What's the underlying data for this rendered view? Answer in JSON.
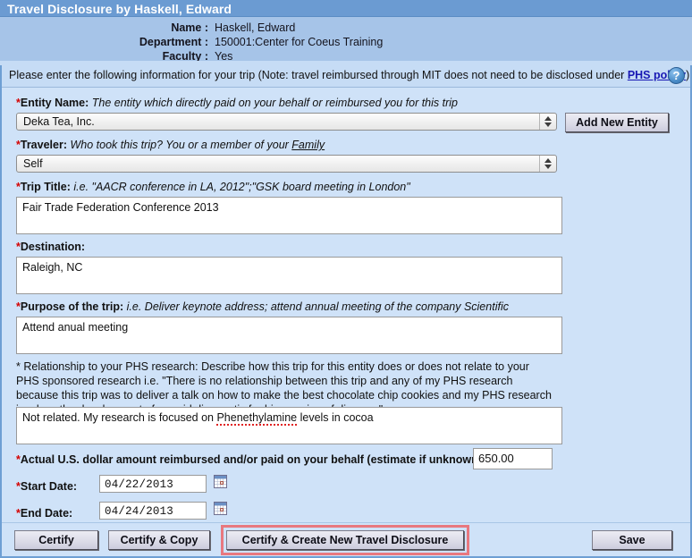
{
  "window": {
    "title": "Travel Disclosure by Haskell, Edward"
  },
  "person_info": {
    "rows": [
      {
        "label": "Name :",
        "value": "Haskell, Edward"
      },
      {
        "label": "Department :",
        "value": "150001:Center for Coeus Training"
      },
      {
        "label": "Faculty :",
        "value": "Yes"
      }
    ]
  },
  "instruction": {
    "text_before": "Please enter the following information for your trip (Note: travel reimbursed through MIT does not need to be disclosed under ",
    "link_label": "PHS policy",
    "text_after": ")",
    "help_icon": "question-mark-icon",
    "help_glyph": "?"
  },
  "fields": {
    "entity_name": {
      "star": "*",
      "label": "Entity Name:",
      "hint": "The entity which directly paid on your behalf or reimbursed you for this trip",
      "selected_value": "Deka Tea, Inc.",
      "add_button_label": "Add New Entity"
    },
    "traveler": {
      "star": "*",
      "label": "Traveler:",
      "hint_part1": "Who took this trip? You or a member of your ",
      "hint_link": "Family",
      "selected_value": "Self"
    },
    "trip_title": {
      "star": "*",
      "label": "Trip Title:",
      "hint": "i.e. \"AACR conference in LA, 2012\";\"GSK board meeting in London\"",
      "value": "Fair Trade Federation Conference 2013"
    },
    "destination": {
      "star": "*",
      "label": "Destination:",
      "hint": "",
      "value": "Raleigh, NC"
    },
    "purpose": {
      "star": "*",
      "label": "Purpose of the trip:",
      "hint": "i.e. Deliver keynote address; attend annual meeting of the company Scientific",
      "value": "Attend anual meeting"
    },
    "relationship": {
      "star": "*",
      "label": "Relationship to your PHS research:",
      "hint": "Describe how this trip for this entity does or does not relate to your PHS sponsored research i.e. \"There is no relationship between this trip and any of my PHS research because this trip was to deliver a talk on how to make the best chocolate chip cookies and my PHS research involves the development of a rapid diagnostic for bio-sensing of disease.\"",
      "value_before_spell": "Not related. My research is focused on ",
      "value_spell": "Phenethylamine",
      "value_after_spell": " levels in cocoa"
    },
    "amount": {
      "star": "*",
      "label": "Actual U.S. dollar amount reimbursed and/or paid on your behalf (estimate if unknown): $",
      "value": "650.00"
    },
    "start_date": {
      "star": "*",
      "label": "Start Date:",
      "value": "04/22/2013",
      "calendar_icon": "calendar-icon"
    },
    "end_date": {
      "star": "*",
      "label": "End Date:",
      "value": "04/24/2013",
      "calendar_icon": "calendar-icon"
    }
  },
  "actions": {
    "certify": "Certify",
    "certify_copy": "Certify & Copy",
    "certify_create": "Certify & Create  New Travel Disclosure",
    "save": "Save"
  },
  "colors": {
    "title_bar": "#6b9bd2",
    "info_band": "#a6c4e8",
    "panel_bg": "#cfe2f8",
    "instruction_bg": "#c6dcf5",
    "required_star": "#d40000",
    "link": "#1818b4",
    "highlight_outline": "#e8787f"
  }
}
